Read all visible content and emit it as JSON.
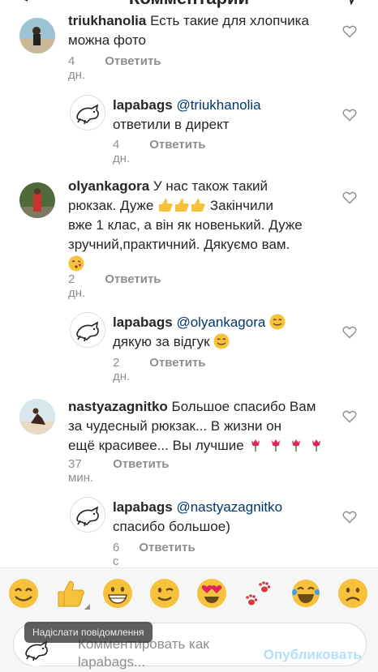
{
  "header": {
    "title": "Комментарии"
  },
  "comments": [
    {
      "username": "triukhanolia",
      "text": "Есть такие для хлопчика можна фото",
      "line1_rest": "Есть такие для хлопчика",
      "line2": "можна фото",
      "time": "4 дн.",
      "reply_label": "Ответить"
    },
    {
      "username": "lapabags",
      "mention": "@triukhanolia",
      "line2": "ответили в директ",
      "time": "4 дн.",
      "reply_label": "Ответить"
    },
    {
      "username": "olyankagora",
      "line1_rest": "У нас також такий",
      "line2": "рюкзак. Дуже",
      "line2_rest": "Закінчили",
      "line3": "вже 1 клас, а він як новенький. Дуже",
      "line4": "зручний,практичний. Дякуємо  вам.",
      "time": "2 дн.",
      "reply_label": "Ответить"
    },
    {
      "username": "lapabags",
      "mention": "@olyankagora",
      "line2": "дякую за відгук",
      "time": "2 дн.",
      "reply_label": "Ответить"
    },
    {
      "username": "nastyazagnitko",
      "line1_rest": "Большое спасибо Вам",
      "line2": "за чудесный рюкзак... В жизни он",
      "line3": "ещё красивее... Вы лучшие",
      "time": "37 мин.",
      "reply_label": "Ответить"
    },
    {
      "username": "lapabags",
      "mention": "@nastyazagnitko",
      "line2": "спасибо большое)",
      "time": "6 с",
      "reply_label": "Ответить"
    }
  ],
  "input": {
    "tooltip": "Надіслати повідомлення",
    "placeholder": "Комментировать как lapabags...",
    "publish_label": "Опубликовать"
  },
  "emoji_bar": [
    "smile-emoji",
    "thumbs-up-emoji",
    "grin-emoji",
    "wink-emoji",
    "heart-eyes-emoji",
    "paw-emoji",
    "tears-of-joy-emoji",
    "frown-emoji"
  ],
  "colors": {
    "text": "#262626",
    "muted": "#8e8e8e",
    "mention": "#00376b",
    "publish": "#b2dffc"
  }
}
